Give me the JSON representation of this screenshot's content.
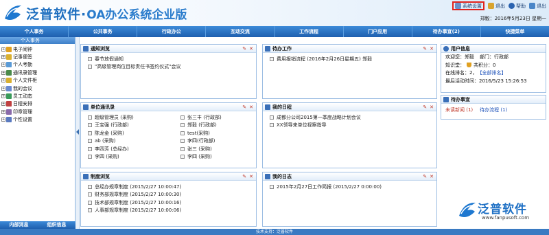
{
  "header": {
    "brand": "泛普软件",
    "dot": "·",
    "subtitle": "OA办公系统企业版",
    "links": [
      {
        "label": "系统设置",
        "icon": "settings-icon"
      },
      {
        "label": "退出",
        "icon": "exit-icon"
      },
      {
        "label": "帮助",
        "icon": "help-icon"
      },
      {
        "label": "退出",
        "icon": "logout-icon"
      }
    ],
    "date": "郑毅：2016年5月23日 星期一"
  },
  "nav": [
    "个人事务",
    "公共事务",
    "行政办公",
    "互动交流",
    "工作流程",
    "门户应用",
    "待办事宜(2)",
    "快捷菜单"
  ],
  "sidebar": {
    "title": "个人事务",
    "items": [
      {
        "label": "电子闹钟",
        "color": "#e0a020"
      },
      {
        "label": "记事便签",
        "color": "#d9b030"
      },
      {
        "label": "个人考勤",
        "color": "#5a9ad6"
      },
      {
        "label": "通讯录管理",
        "color": "#4a8a4a"
      },
      {
        "label": "个人文件柜",
        "color": "#d9b030"
      },
      {
        "label": "我的会议",
        "color": "#6a8ad0"
      },
      {
        "label": "员工动态",
        "color": "#3a9a5a"
      },
      {
        "label": "日程安排",
        "color": "#c04040"
      },
      {
        "label": "印章管理",
        "color": "#8a6aaa"
      },
      {
        "label": "个性设置",
        "color": "#5a7ac0"
      }
    ],
    "footer": [
      "内部消息",
      "组织信息"
    ]
  },
  "panels": {
    "notice": {
      "title": "通知浏览",
      "items": [
        "春节放假通知",
        "\"高级管理岗位目标责任书签约仪式\"会议"
      ]
    },
    "contacts": {
      "title": "单位通讯录",
      "items": [
        "超级管理员 (采购)",
        "张三丰 (行政部)",
        "王宝强 (行政部)",
        "郑毅 (行政部)",
        "陈龙金 (采购)",
        "test(采购)",
        "ab (采购)",
        "李四(行政部)",
        "李四芳 (总经办)",
        "张三 (采购)",
        "李四 (采购)",
        "李四 (采购)"
      ]
    },
    "system": {
      "title": "制度浏览",
      "items": [
        "总经办规章制度 (2015/2/27 10:00:47)",
        "财务部规章制度 (2015/2/27 10:00:30)",
        "技术部规章制度 (2015/2/27 10:00:16)",
        "人事部规章制度 (2015/2/27 10:00:06)"
      ]
    },
    "todo": {
      "title": "待办工作",
      "items": [
        "费用报销流程 (2016年2月26日星期五) 郑毅"
      ]
    },
    "schedule": {
      "title": "我的日程",
      "items": [
        "成都分公司2015第一季度战略计划会议",
        "XX领导来单位视察指导"
      ]
    },
    "log": {
      "title": "我的日志",
      "items": [
        "2015年2月27日工作简报 (2015/2/27 0:00:00)"
      ]
    },
    "user": {
      "title": "用户信息",
      "welcome": "欢迎您：郑毅",
      "dept": "部门：行政部",
      "knowledge": "知识堂：",
      "points": "共积分：0",
      "online": "在线排名：2，",
      "rank_link": "【全部排名】",
      "last_login": "最后活动时间：2016/5/23 15:26:53"
    },
    "pending": {
      "title": "待办事宜",
      "unread": "未读新闻 (1)",
      "flows": "待办流程 (1)"
    }
  },
  "watermark": {
    "text": "泛普软件",
    "url": "www.fanpusoft.com"
  },
  "footer": "技术支持：泛普软件"
}
